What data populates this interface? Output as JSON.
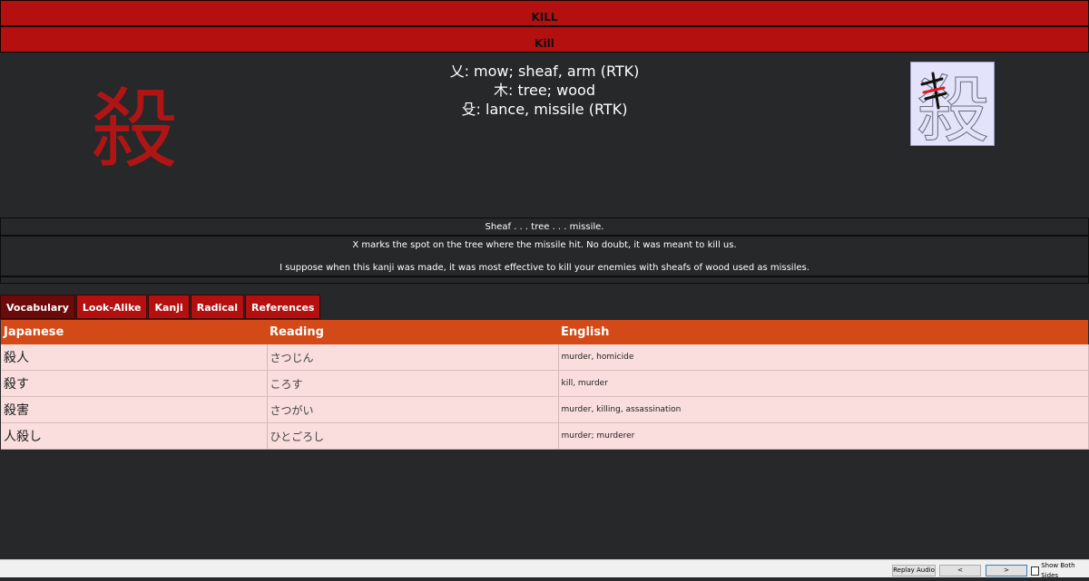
{
  "header": {
    "keyword_upper": "KILL",
    "keyword": "Kill"
  },
  "kanji": {
    "character": "殺",
    "components": [
      "乂: mow; sheaf, arm (RTK)",
      "木: tree; wood",
      "殳: lance, missile (RTK)"
    ]
  },
  "stroke_order": {
    "character": "殺",
    "highlight_color": "#e11c1c"
  },
  "mnemonic": {
    "summary": "Sheaf . . . tree . . . missile.",
    "line1": "X marks the spot on the tree where the missile hit. No doubt, it was meant to kill us.",
    "line2": "I suppose when this kanji was made, it was most effective to kill your enemies with sheafs of wood used as missiles."
  },
  "tabs": [
    {
      "label": "Vocabulary",
      "active": true
    },
    {
      "label": "Look-Alike",
      "active": false
    },
    {
      "label": "Kanji",
      "active": false
    },
    {
      "label": "Radical",
      "active": false
    },
    {
      "label": "References",
      "active": false
    }
  ],
  "vocabulary": {
    "headers": [
      "Japanese",
      "Reading",
      "English"
    ],
    "rows": [
      {
        "japanese": "殺人",
        "reading": "さつじん",
        "english": "murder, homicide"
      },
      {
        "japanese": "殺す",
        "reading": "ころす",
        "english": "kill, murder"
      },
      {
        "japanese": "殺害",
        "reading": "さつがい",
        "english": "murder, killing, assassination"
      },
      {
        "japanese": "人殺し",
        "reading": "ひとごろし",
        "english": "murder; murderer"
      }
    ]
  },
  "bottom_bar": {
    "replay_audio": "Replay Audio",
    "prev": "<",
    "next": ">",
    "show_both_sides": "Show Both Sides"
  },
  "colors": {
    "banner": "#b51010",
    "kanji": "#b01515",
    "table_header": "#d34a18",
    "table_row": "#fadddd",
    "background": "#272829"
  }
}
